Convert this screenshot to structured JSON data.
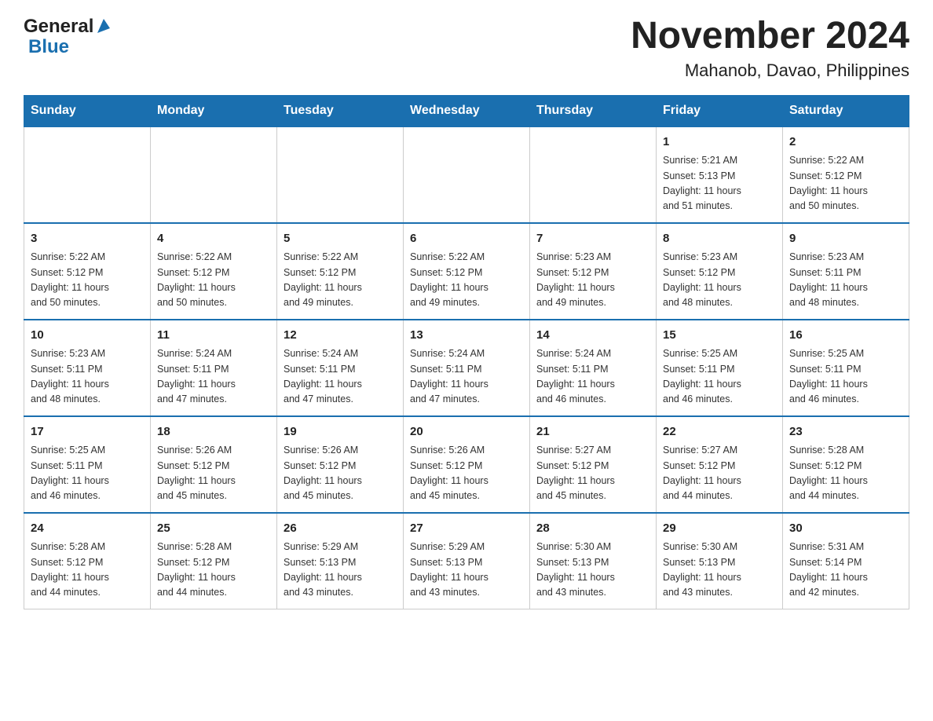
{
  "header": {
    "logo_line1": "General",
    "logo_line2": "Blue",
    "title": "November 2024",
    "subtitle": "Mahanob, Davao, Philippines"
  },
  "days_of_week": [
    "Sunday",
    "Monday",
    "Tuesday",
    "Wednesday",
    "Thursday",
    "Friday",
    "Saturday"
  ],
  "weeks": [
    [
      {
        "day": "",
        "info": ""
      },
      {
        "day": "",
        "info": ""
      },
      {
        "day": "",
        "info": ""
      },
      {
        "day": "",
        "info": ""
      },
      {
        "day": "",
        "info": ""
      },
      {
        "day": "1",
        "info": "Sunrise: 5:21 AM\nSunset: 5:13 PM\nDaylight: 11 hours\nand 51 minutes."
      },
      {
        "day": "2",
        "info": "Sunrise: 5:22 AM\nSunset: 5:12 PM\nDaylight: 11 hours\nand 50 minutes."
      }
    ],
    [
      {
        "day": "3",
        "info": "Sunrise: 5:22 AM\nSunset: 5:12 PM\nDaylight: 11 hours\nand 50 minutes."
      },
      {
        "day": "4",
        "info": "Sunrise: 5:22 AM\nSunset: 5:12 PM\nDaylight: 11 hours\nand 50 minutes."
      },
      {
        "day": "5",
        "info": "Sunrise: 5:22 AM\nSunset: 5:12 PM\nDaylight: 11 hours\nand 49 minutes."
      },
      {
        "day": "6",
        "info": "Sunrise: 5:22 AM\nSunset: 5:12 PM\nDaylight: 11 hours\nand 49 minutes."
      },
      {
        "day": "7",
        "info": "Sunrise: 5:23 AM\nSunset: 5:12 PM\nDaylight: 11 hours\nand 49 minutes."
      },
      {
        "day": "8",
        "info": "Sunrise: 5:23 AM\nSunset: 5:12 PM\nDaylight: 11 hours\nand 48 minutes."
      },
      {
        "day": "9",
        "info": "Sunrise: 5:23 AM\nSunset: 5:11 PM\nDaylight: 11 hours\nand 48 minutes."
      }
    ],
    [
      {
        "day": "10",
        "info": "Sunrise: 5:23 AM\nSunset: 5:11 PM\nDaylight: 11 hours\nand 48 minutes."
      },
      {
        "day": "11",
        "info": "Sunrise: 5:24 AM\nSunset: 5:11 PM\nDaylight: 11 hours\nand 47 minutes."
      },
      {
        "day": "12",
        "info": "Sunrise: 5:24 AM\nSunset: 5:11 PM\nDaylight: 11 hours\nand 47 minutes."
      },
      {
        "day": "13",
        "info": "Sunrise: 5:24 AM\nSunset: 5:11 PM\nDaylight: 11 hours\nand 47 minutes."
      },
      {
        "day": "14",
        "info": "Sunrise: 5:24 AM\nSunset: 5:11 PM\nDaylight: 11 hours\nand 46 minutes."
      },
      {
        "day": "15",
        "info": "Sunrise: 5:25 AM\nSunset: 5:11 PM\nDaylight: 11 hours\nand 46 minutes."
      },
      {
        "day": "16",
        "info": "Sunrise: 5:25 AM\nSunset: 5:11 PM\nDaylight: 11 hours\nand 46 minutes."
      }
    ],
    [
      {
        "day": "17",
        "info": "Sunrise: 5:25 AM\nSunset: 5:11 PM\nDaylight: 11 hours\nand 46 minutes."
      },
      {
        "day": "18",
        "info": "Sunrise: 5:26 AM\nSunset: 5:12 PM\nDaylight: 11 hours\nand 45 minutes."
      },
      {
        "day": "19",
        "info": "Sunrise: 5:26 AM\nSunset: 5:12 PM\nDaylight: 11 hours\nand 45 minutes."
      },
      {
        "day": "20",
        "info": "Sunrise: 5:26 AM\nSunset: 5:12 PM\nDaylight: 11 hours\nand 45 minutes."
      },
      {
        "day": "21",
        "info": "Sunrise: 5:27 AM\nSunset: 5:12 PM\nDaylight: 11 hours\nand 45 minutes."
      },
      {
        "day": "22",
        "info": "Sunrise: 5:27 AM\nSunset: 5:12 PM\nDaylight: 11 hours\nand 44 minutes."
      },
      {
        "day": "23",
        "info": "Sunrise: 5:28 AM\nSunset: 5:12 PM\nDaylight: 11 hours\nand 44 minutes."
      }
    ],
    [
      {
        "day": "24",
        "info": "Sunrise: 5:28 AM\nSunset: 5:12 PM\nDaylight: 11 hours\nand 44 minutes."
      },
      {
        "day": "25",
        "info": "Sunrise: 5:28 AM\nSunset: 5:12 PM\nDaylight: 11 hours\nand 44 minutes."
      },
      {
        "day": "26",
        "info": "Sunrise: 5:29 AM\nSunset: 5:13 PM\nDaylight: 11 hours\nand 43 minutes."
      },
      {
        "day": "27",
        "info": "Sunrise: 5:29 AM\nSunset: 5:13 PM\nDaylight: 11 hours\nand 43 minutes."
      },
      {
        "day": "28",
        "info": "Sunrise: 5:30 AM\nSunset: 5:13 PM\nDaylight: 11 hours\nand 43 minutes."
      },
      {
        "day": "29",
        "info": "Sunrise: 5:30 AM\nSunset: 5:13 PM\nDaylight: 11 hours\nand 43 minutes."
      },
      {
        "day": "30",
        "info": "Sunrise: 5:31 AM\nSunset: 5:14 PM\nDaylight: 11 hours\nand 42 minutes."
      }
    ]
  ]
}
